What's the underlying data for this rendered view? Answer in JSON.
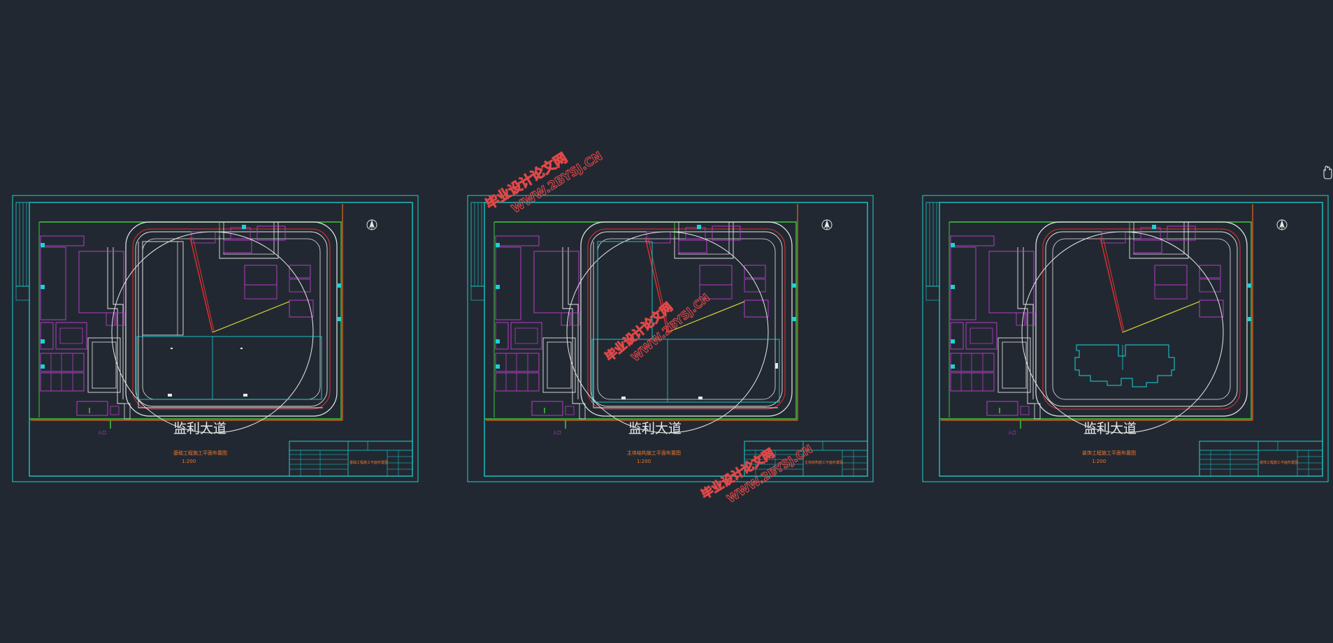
{
  "road_name": "监利大道",
  "north_mark": "北",
  "scale": "1:200",
  "sheets": [
    {
      "title": "基础工程施工平面布置图",
      "title_block_title": "基础工程施工平面布置图",
      "phase": "foundation"
    },
    {
      "title": "主体结构施工平面布置图",
      "title_block_title": "主体结构施工平面布置图",
      "phase": "structure"
    },
    {
      "title": "装饰工程施工平面布置图",
      "title_block_title": "装饰工程施工平面布置图",
      "phase": "decoration"
    }
  ],
  "watermark": {
    "line1": "毕业设计论文网",
    "line2": "WWW.2BYSJ.CN"
  },
  "colors": {
    "background": "#222831",
    "frame": "#19d3d6",
    "building": "#b43cc8",
    "site_boundary": "#3ec83e",
    "road": "#e8e8e8",
    "red_line": "#e63030",
    "crane_arm": "#e6e632",
    "title_text": "#f07830",
    "watermark": "#e04848"
  },
  "icons": [
    "hand-cursor-icon",
    "north-arrow-icon"
  ]
}
